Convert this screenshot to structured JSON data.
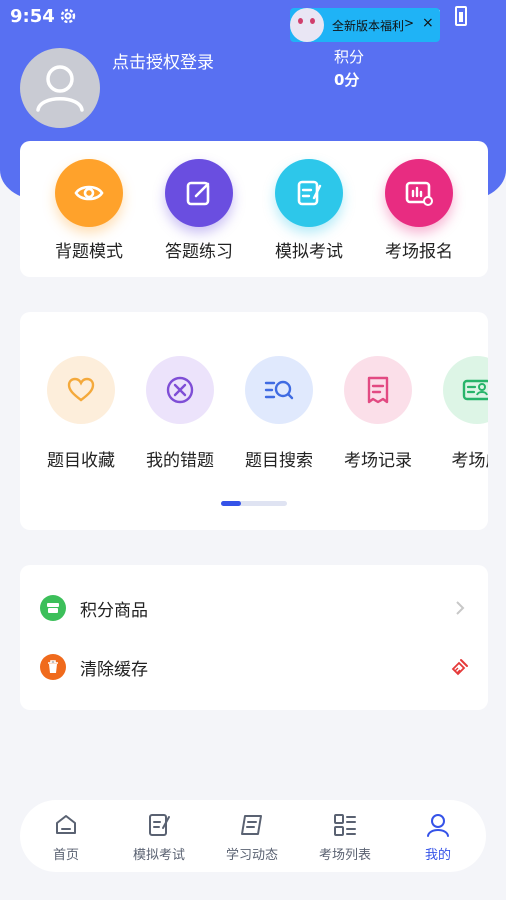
{
  "status_bar": {
    "time": "9:54"
  },
  "promo": {
    "text": "全新版本福利",
    "chevron": ">",
    "close": "×"
  },
  "profile": {
    "login_text": "点击授权登录",
    "points_label": "积分",
    "points_value": "0分"
  },
  "quick_actions": [
    {
      "label": "背题模式",
      "icon": "eye-icon",
      "color": "#ffa22b"
    },
    {
      "label": "答题练习",
      "icon": "edit-icon",
      "color": "#6a4ee0"
    },
    {
      "label": "模拟考试",
      "icon": "exam-paper-icon",
      "color": "#2dc7ea"
    },
    {
      "label": "考场报名",
      "icon": "chart-board-icon",
      "color": "#e82c81"
    }
  ],
  "tools": {
    "items": [
      {
        "label": "题目收藏",
        "icon": "heart-icon",
        "color": "#f4a93b"
      },
      {
        "label": "我的错题",
        "icon": "x-circle-icon",
        "color": "#7f4ed6"
      },
      {
        "label": "题目搜索",
        "icon": "search-list-icon",
        "color": "#3f6be2"
      },
      {
        "label": "考场记录",
        "icon": "receipt-icon",
        "color": "#e24a82"
      },
      {
        "label": "考场成",
        "icon": "id-card-icon",
        "color": "#27b46a"
      }
    ],
    "pager_progress": 0.3
  },
  "menu": [
    {
      "label": "积分商品",
      "icon": "store-icon",
      "color": "#3cbf5a"
    },
    {
      "label": "清除缓存",
      "icon": "trash-icon",
      "color": "#f06a1c"
    }
  ],
  "tabbar": [
    {
      "label": "首页",
      "icon": "home-icon",
      "active": false
    },
    {
      "label": "模拟考试",
      "icon": "exam-paper-icon",
      "active": false
    },
    {
      "label": "学习动态",
      "icon": "news-icon",
      "active": false
    },
    {
      "label": "考场列表",
      "icon": "grid-list-icon",
      "active": false
    },
    {
      "label": "我的",
      "icon": "user-icon",
      "active": true
    }
  ]
}
